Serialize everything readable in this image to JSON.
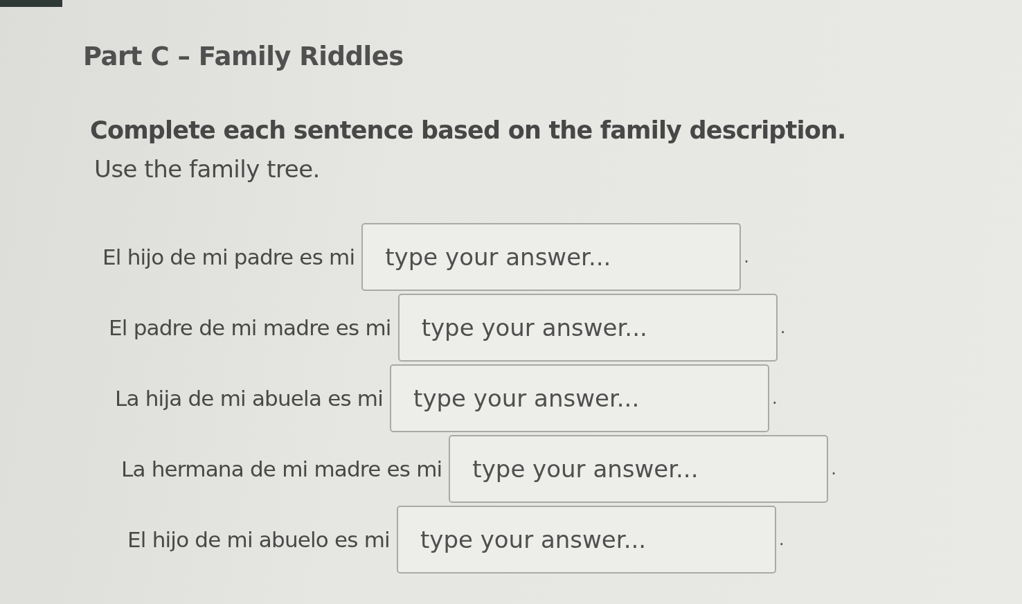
{
  "title": "Part C – Family Riddles",
  "instructions": {
    "heading": "Complete each sentence based on the family description.",
    "note": "Use the family tree."
  },
  "items": [
    {
      "prompt": "El hijo de mi padre es mi",
      "answer": {
        "placeholder": "type your answer..."
      },
      "end_mark": "."
    },
    {
      "prompt": "El padre de mi madre es mi",
      "answer": {
        "placeholder": "type your answer..."
      },
      "end_mark": "."
    },
    {
      "prompt": "La hija de mi abuela es mi",
      "answer": {
        "placeholder": "type your answer..."
      },
      "end_mark": "."
    },
    {
      "prompt": "La hermana de mi madre es mi",
      "answer": {
        "placeholder": "type your answer..."
      },
      "end_mark": "."
    },
    {
      "prompt": "El hijo de mi abuelo es mi",
      "answer": {
        "placeholder": "type your answer..."
      },
      "end_mark": "."
    }
  ]
}
